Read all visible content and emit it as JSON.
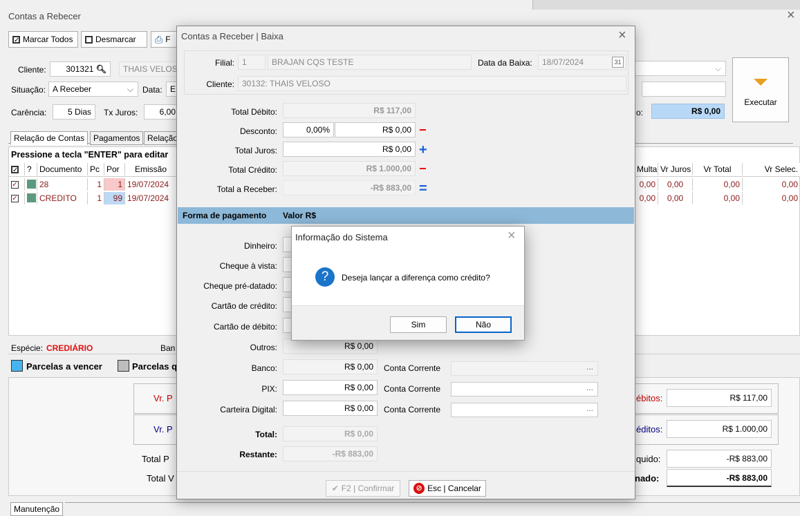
{
  "main": {
    "title": "Contas a Rebecer",
    "close": "×",
    "toolbar": {
      "mark_all": "Marcar Todos",
      "unmark": "Desmarcar",
      "print": "F"
    },
    "cliente_label": "Cliente:",
    "cliente_code": "301321",
    "cliente_name": "THAIS VELOSO",
    "situacao_label": "Situação:",
    "situacao_value": "A Receber",
    "data_label": "Data:",
    "data_value": "E",
    "carencia_label": "Carência:",
    "carencia_value": "5 Dias",
    "txjuros_label": "Tx Juros:",
    "txjuros_value": "6,00",
    "right_total_label": "o:",
    "right_total_value": "R$ 0,00",
    "executar": "Executar",
    "tabs": [
      "Relação de Contas",
      "Pagamentos",
      "Relação"
    ],
    "enter_hint": "Pressione a tecla \"ENTER\" para editar",
    "grid": {
      "headers": [
        "?",
        "Documento",
        "Pc",
        "Por",
        "Emissão"
      ],
      "right_headers": [
        "Multa",
        "Vr Juros",
        "Vr Total",
        "Vr Selec."
      ],
      "rows": [
        {
          "doc": "28",
          "pc": "1",
          "por": "1",
          "emissao": "19/07/2024",
          "multa": "0,00",
          "juros": "0,00",
          "total": "0,00",
          "selec": "0,00"
        },
        {
          "doc": "CREDITO",
          "pc": "1",
          "por": "99",
          "emissao": "19/07/2024",
          "multa": "0,00",
          "juros": "0,00",
          "total": "0,00",
          "selec": "0,00"
        }
      ]
    },
    "especie_label": "Espécie:",
    "especie_value": "CREDIÁRIO",
    "banco_label": "Ban",
    "legend_vencer": "Parcelas a vencer",
    "legend_q": "Parcelas q",
    "summary_left": [
      "Vr. P",
      "Vr. P",
      "Total P",
      "Total V"
    ],
    "summary_right_labels": [
      "ébitos:",
      "éditos:",
      "quido:",
      "nado:"
    ],
    "summary_right_values": [
      "R$ 117,00",
      "R$ 1.000,00",
      "-R$ 883,00",
      "-R$ 883,00"
    ],
    "manutencao": "Manutenção"
  },
  "baixa": {
    "title": "Contas a Receber | Baixa",
    "close": "×",
    "filial_label": "Filial:",
    "filial_code": "1",
    "filial_name": "BRAJAN CQS TESTE",
    "data_baixa_label": "Data da Baixa:",
    "data_baixa_value": "18/07/2024",
    "cal_icon": "31",
    "cliente_label": "Cliente:",
    "cliente_value": "30132: THAIS VELOSO",
    "total_debito_label": "Total Débito:",
    "total_debito_value": "R$ 117,00",
    "desconto_label": "Desconto:",
    "desconto_pct": "0,00%",
    "desconto_value": "R$ 0,00",
    "total_juros_label": "Total Juros:",
    "total_juros_value": "R$ 0,00",
    "total_credito_label": "Total Crédito:",
    "total_credito_value": "R$ 1.000,00",
    "total_receber_label": "Total a Receber:",
    "total_receber_value": "-R$ 883,00",
    "minus": "−",
    "plus": "+",
    "equals": "=",
    "forma_header": "Forma de pagamento",
    "valor_header": "Valor R$",
    "payments": [
      {
        "label": "Dinheiro:",
        "value": ""
      },
      {
        "label": "Cheque à vista:",
        "value": ""
      },
      {
        "label": "Cheque pré-datado:",
        "value": ""
      },
      {
        "label": "Cartão de crédito:",
        "value": ""
      },
      {
        "label": "Cartão de débito:",
        "value": ""
      },
      {
        "label": "Outros:",
        "value": "R$ 0,00"
      },
      {
        "label": "Banco:",
        "value": "R$ 0,00",
        "cc": "Conta Corrente"
      },
      {
        "label": "PIX:",
        "value": "R$ 0,00",
        "cc": "Conta Corrente"
      },
      {
        "label": "Carteira Digital:",
        "value": "R$ 0,00",
        "cc": "Conta Corrente"
      }
    ],
    "ellipsis": "...",
    "total_label": "Total:",
    "total_value": "R$ 0,00",
    "restante_label": "Restante:",
    "restante_value": "-R$ 883,00",
    "confirm": "F2 | Confirmar",
    "cancel": "Esc | Cancelar"
  },
  "info": {
    "title": "Informação do Sistema",
    "close": "×",
    "icon": "?",
    "message": "Deseja lançar a diferença como crédito?",
    "yes": "Sim",
    "no": "Não"
  }
}
